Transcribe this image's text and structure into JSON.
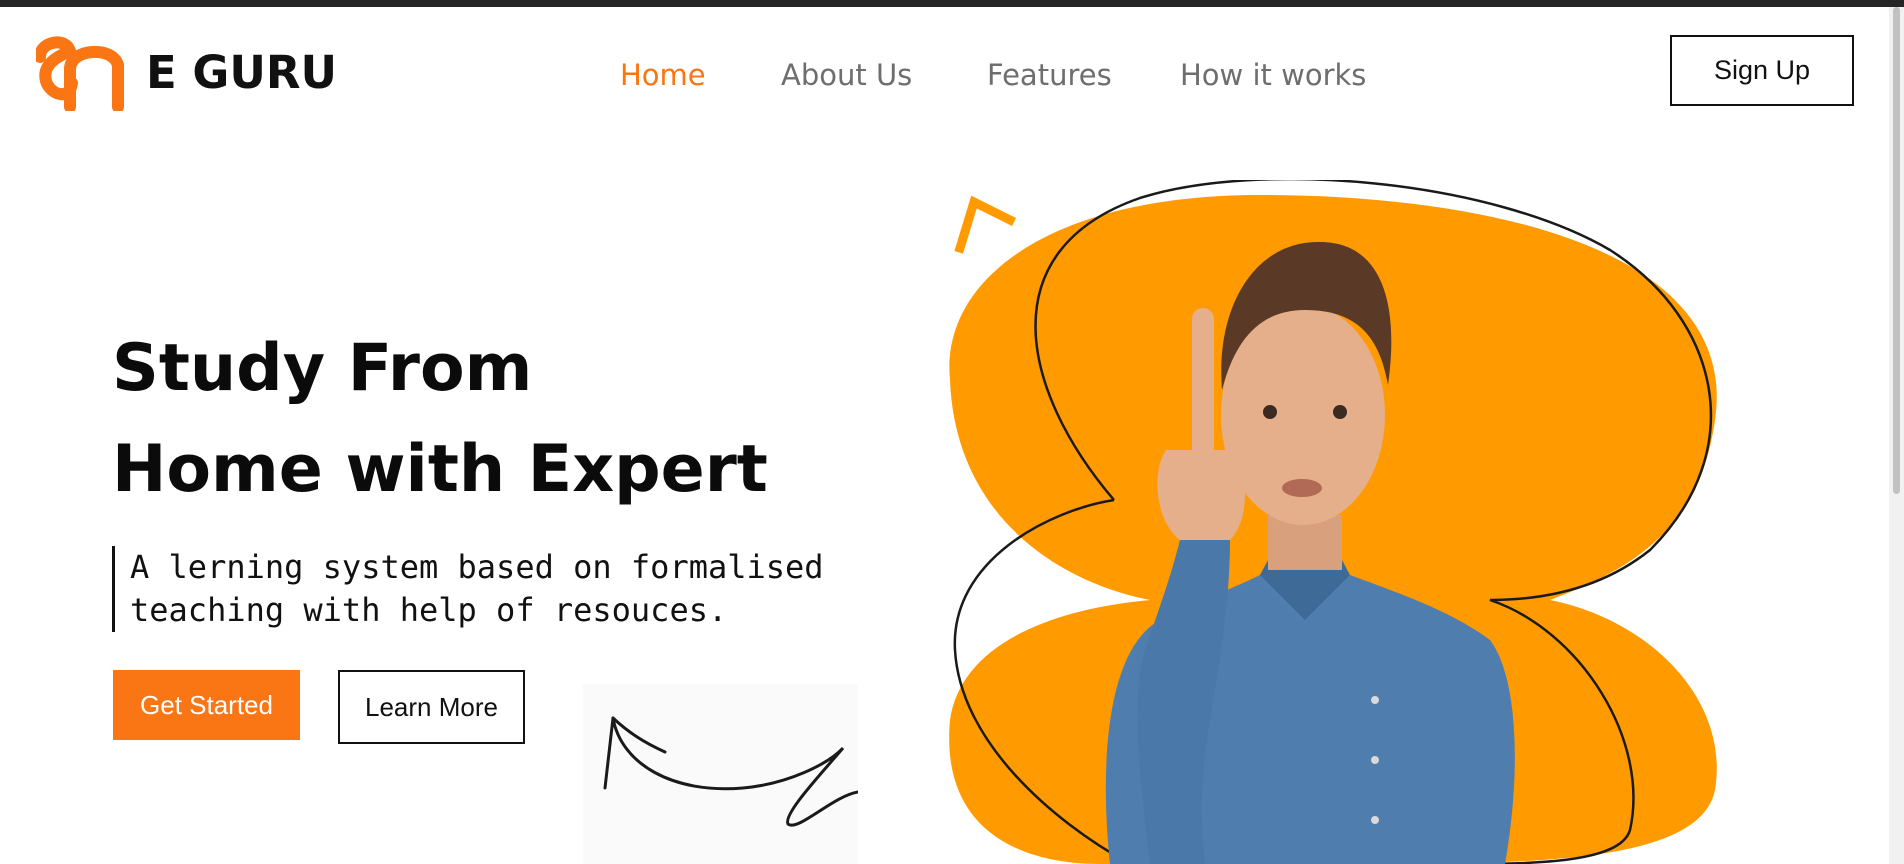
{
  "brand": {
    "name": "E GURU",
    "logo_icon": "eguru-logo-icon",
    "color": "#fa7514"
  },
  "nav": {
    "items": [
      {
        "label": "Home",
        "active": true
      },
      {
        "label": "About Us",
        "active": false
      },
      {
        "label": "Features",
        "active": false
      },
      {
        "label": "How it works",
        "active": false
      }
    ],
    "signup_label": "Sign Up"
  },
  "hero": {
    "title_line1": "Study From",
    "title_line2": "Home with Expert",
    "subtitle_line1": "A lerning system based on formalised",
    "subtitle_line2": "teaching with help of resouces.",
    "primary_button": "Get Started",
    "secondary_button": "Learn More"
  },
  "colors": {
    "accent": "#fa7514",
    "blob": "#ff9b00",
    "text": "#111111",
    "nav_text": "#6e6e6e"
  }
}
